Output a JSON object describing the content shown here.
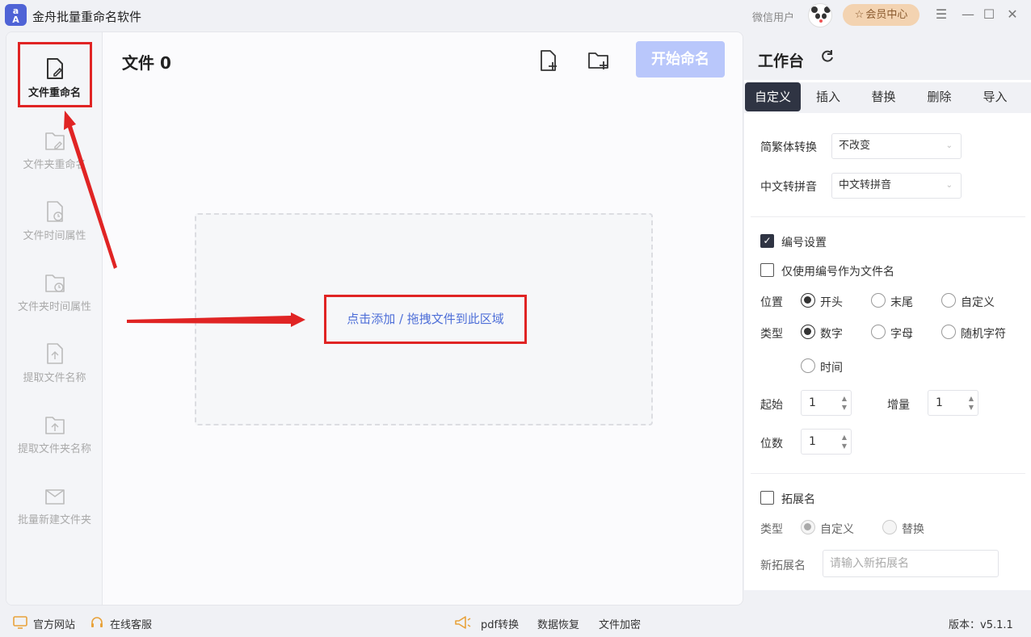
{
  "app": {
    "title": "金舟批量重命名软件",
    "logo_text_top": "a",
    "logo_text_bottom": "A",
    "user": "微信用户",
    "vip_label": "会员中心"
  },
  "sidebar": {
    "items": [
      {
        "label": "文件重命名",
        "icon": "file-edit-icon",
        "active": true
      },
      {
        "label": "文件夹重命名",
        "icon": "folder-edit-icon"
      },
      {
        "label": "文件时间属性",
        "icon": "file-clock-icon"
      },
      {
        "label": "文件夹时间属性",
        "icon": "folder-clock-icon"
      },
      {
        "label": "提取文件名称",
        "icon": "file-upload-icon"
      },
      {
        "label": "提取文件夹名称",
        "icon": "folder-upload-icon"
      },
      {
        "label": "批量新建文件夹",
        "icon": "folder-new-icon"
      }
    ]
  },
  "content": {
    "title": "文件 0",
    "start_button": "开始命名",
    "drop_text": "点击添加 / 拖拽文件到此区域"
  },
  "panel": {
    "title": "工作台",
    "tabs": [
      "自定义",
      "插入",
      "替换",
      "删除",
      "导入"
    ],
    "active_tab": 0,
    "simplified_traditional": {
      "label": "简繁体转换",
      "value": "不改变"
    },
    "pinyin": {
      "label": "中文转拼音",
      "value": "中文转拼音"
    },
    "numbering": {
      "label": "编号设置",
      "checked": true,
      "only_number": {
        "label": "仅使用编号作为文件名",
        "checked": false
      },
      "position": {
        "label": "位置",
        "options": [
          "开头",
          "末尾",
          "自定义"
        ],
        "selected": 0
      },
      "type": {
        "label": "类型",
        "options": [
          "数字",
          "字母",
          "随机字符",
          "时间"
        ],
        "selected": 0
      },
      "start": {
        "label": "起始",
        "value": "1"
      },
      "increment": {
        "label": "增量",
        "value": "1"
      },
      "digits": {
        "label": "位数",
        "value": "1"
      }
    },
    "extension": {
      "label": "拓展名",
      "checked": false,
      "type_label": "类型",
      "type_options": [
        "自定义",
        "替换"
      ],
      "type_selected": 0,
      "new_ext_label": "新拓展名",
      "new_ext_placeholder": "请输入新拓展名"
    }
  },
  "statusbar": {
    "website": "官方网站",
    "service": "在线客服",
    "pdf": "pdf转换",
    "recovery": "数据恢复",
    "encrypt": "文件加密",
    "version": "版本：v5.1.1"
  },
  "colors": {
    "accent_dark": "#2f3443",
    "start_button_disabled": "#b9c7fb",
    "link_blue": "#4e6fd8",
    "annotation_red": "#e02424",
    "vip_bg": "#f3d3b1"
  }
}
